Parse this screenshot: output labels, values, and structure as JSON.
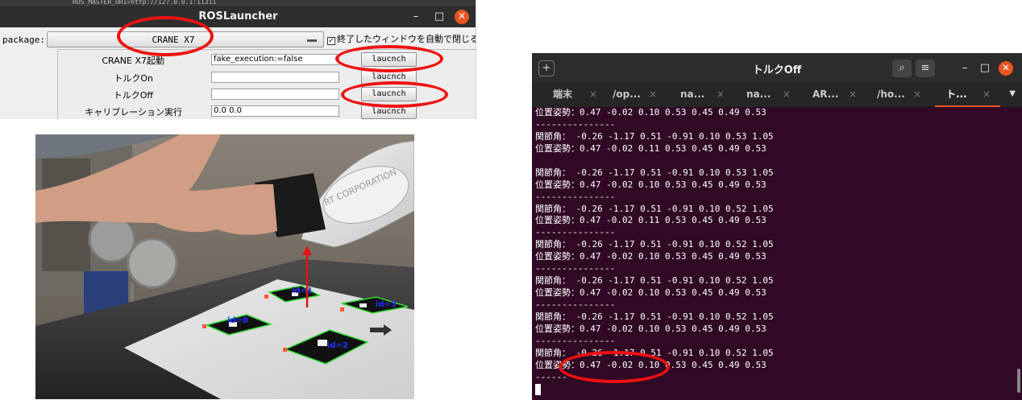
{
  "ros_launcher": {
    "top_strip_text": "ROS_MASTER_URI=http://127.0.0.1:11311",
    "title": "ROSLauncher",
    "minimize": "–",
    "maximize": "□",
    "close": "✕",
    "package_label": "package:",
    "package_value": "CRANE X7",
    "auto_close_check": "✓",
    "auto_close_label": "終了したウィンドウを自動で閉じる",
    "rows": [
      {
        "label": "CRANE X7起動",
        "value": "fake_execution:=false",
        "button": "laucnch"
      },
      {
        "label": "トルクOn",
        "value": "",
        "button": "laucnch"
      },
      {
        "label": "トルクOff",
        "value": "",
        "button": "laucnch"
      },
      {
        "label": "キャリブレーション実行",
        "value": "0.0 0.0",
        "button": "laucnch"
      }
    ]
  },
  "camera": {
    "markers": [
      {
        "label": "id=1"
      },
      {
        "label": "id=3"
      },
      {
        "label": "id=0"
      },
      {
        "label": "id=2"
      }
    ],
    "robot_text": "RT CORPORATION"
  },
  "terminal": {
    "new_tab_icon": "+",
    "title": "トルクOff",
    "search_icon": "⌕",
    "menu_icon": "≡",
    "minimize": "–",
    "maximize": "□",
    "close": "✕",
    "tabs": [
      {
        "label": "端末"
      },
      {
        "label": "/op..."
      },
      {
        "label": "na..."
      },
      {
        "label": "na..."
      },
      {
        "label": "AR..."
      },
      {
        "label": "/ho..."
      },
      {
        "label": "ト..."
      }
    ],
    "tab_close": "×",
    "tabs_menu": "▼",
    "lines": [
      "位置姿勢：0.47 -0.02 0.10 0.53 0.45 0.49 0.53",
      "---------------",
      "関節角： -0.26 -1.17 0.51 -0.91 0.10 0.53 1.05",
      "位置姿勢：0.47 -0.02 0.11 0.53 0.45 0.49 0.53",
      "",
      "関節角： -0.26 -1.17 0.51 -0.91 0.10 0.53 1.05",
      "位置姿勢：0.47 -0.02 0.10 0.53 0.45 0.49 0.53",
      "---------------",
      "関節角： -0.26 -1.17 0.51 -0.91 0.10 0.52 1.05",
      "位置姿勢：0.47 -0.02 0.11 0.53 0.45 0.49 0.53",
      "---------------",
      "関節角： -0.26 -1.17 0.51 -0.91 0.10 0.52 1.05",
      "位置姿勢：0.47 -0.02 0.10 0.53 0.45 0.49 0.53",
      "---------------",
      "関節角： -0.26 -1.17 0.51 -0.91 0.10 0.52 1.05",
      "位置姿勢：0.47 -0.02 0.10 0.53 0.45 0.49 0.53",
      "---------------",
      "関節角： -0.26 -1.17 0.51 -0.91 0.10 0.52 1.05",
      "位置姿勢：0.47 -0.02 0.10 0.53 0.45 0.49 0.53",
      "---------------",
      "関節角： -0.26 -1.17 0.51 -0.91 0.10 0.52 1.05",
      "位置姿勢：0.47 -0.02 0.10 0.53 0.45 0.49 0.53",
      "------"
    ]
  },
  "colors": {
    "terminal_bg": "#300a24",
    "accent": "#e95420",
    "highlight": "#ee1111",
    "marker_label": "#2233ff"
  }
}
